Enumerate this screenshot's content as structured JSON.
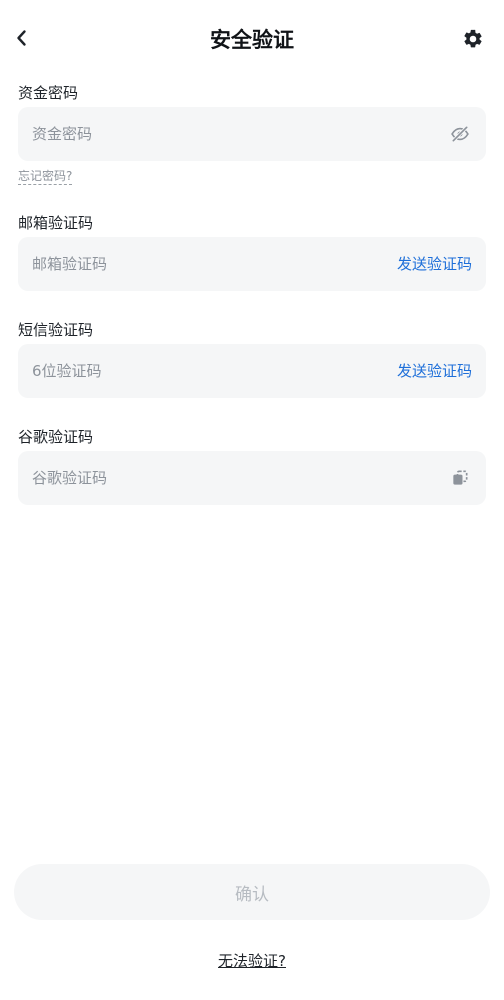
{
  "header": {
    "title": "安全验证",
    "back_icon": "chevron-left-icon",
    "settings_icon": "gear-icon"
  },
  "fund_password": {
    "label": "资金密码",
    "placeholder": "资金密码",
    "value": "",
    "visibility_icon": "eye-off-icon",
    "forgot_label": "忘记密码?"
  },
  "email_code": {
    "label": "邮箱验证码",
    "placeholder": "邮箱验证码",
    "value": "",
    "send_label": "发送验证码"
  },
  "sms_code": {
    "label": "短信验证码",
    "placeholder": "6位验证码",
    "value": "",
    "send_label": "发送验证码"
  },
  "google_code": {
    "label": "谷歌验证码",
    "placeholder": "谷歌验证码",
    "value": "",
    "paste_icon": "paste-icon"
  },
  "footer": {
    "confirm_label": "确认",
    "help_label": "无法验证?"
  },
  "colors": {
    "accent": "#1e6fd9",
    "field_background": "#f5f6f7",
    "placeholder": "#8d939b",
    "disabled_text": "#b7bcc2"
  }
}
